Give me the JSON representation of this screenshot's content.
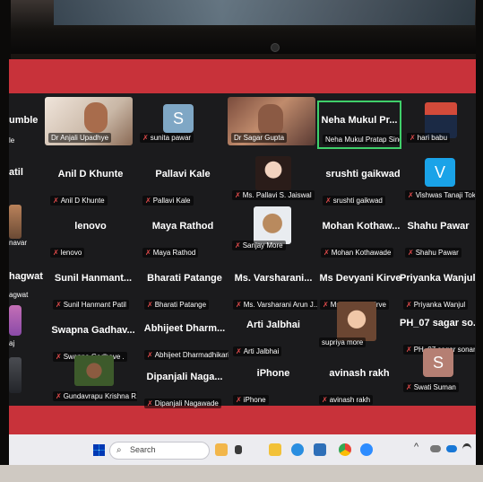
{
  "tiles": [
    {
      "name": "",
      "label": "Dr Anjali Upadhye"
    },
    {
      "name": "",
      "label": "sunita pawar",
      "avatar": "S"
    },
    {
      "name": "",
      "label": "Dr Sagar Gupta"
    },
    {
      "name": "Neha Mukul Pr...",
      "label": "Neha Mukul Pratap Singh"
    },
    {
      "name": "",
      "label": "hari babu"
    },
    {
      "name": "Anil D Khunte",
      "label": "Anil D Khunte"
    },
    {
      "name": "Pallavi Kale",
      "label": "Pallavi Kale"
    },
    {
      "name": "",
      "label": "Ms. Pallavi S. Jaiswal"
    },
    {
      "name": "srushti gaikwad",
      "label": "srushti gaikwad"
    },
    {
      "name": "",
      "label": "Vishwas Tanaji Toke",
      "avatar": "V"
    },
    {
      "name": "lenovo",
      "label": "lenovo"
    },
    {
      "name": "Maya Rathod",
      "label": "Maya Rathod"
    },
    {
      "name": "",
      "label": "Sanjay More"
    },
    {
      "name": "Mohan Kothaw...",
      "label": "Mohan Kothawade"
    },
    {
      "name": "Shahu Pawar",
      "label": "Shahu Pawar"
    },
    {
      "name": "Sunil Hanmant...",
      "label": "Sunil Hanmant Patil"
    },
    {
      "name": "Bharati Patange",
      "label": "Bharati Patange"
    },
    {
      "name": "Ms. Varsharani...",
      "label": "Ms. Varsharani Arun J..."
    },
    {
      "name": "Ms Devyani Kirve",
      "label": "Ms Devyani Kirve"
    },
    {
      "name": "Priyanka Wanjul",
      "label": "Priyanka Wanjul"
    },
    {
      "name": "Swapna Gadhav...",
      "label": "Swapna Gadhave ."
    },
    {
      "name": "Abhijeet Dharm...",
      "label": "Abhijeet Dharmadhikari"
    },
    {
      "name": "Arti Jalbhai",
      "label": "Arti Jalbhai"
    },
    {
      "name": "",
      "label": "supriya more"
    },
    {
      "name": "PH_07 sagar so...",
      "label": "PH_07 sagar sonar"
    },
    {
      "name": "",
      "label": "Gundavrapu Krishna R..."
    },
    {
      "name": "Dipanjali Naga...",
      "label": "Dipanjali Nagawade"
    },
    {
      "name": "iPhone",
      "label": "iPhone"
    },
    {
      "name": "avinash rakh",
      "label": "avinash rakh"
    },
    {
      "name": "",
      "label": "Swati Suman",
      "avatar": "S"
    }
  ],
  "edge": {
    "row1_name": "umble",
    "row1_label": "le",
    "row2_name": "atil",
    "row3_label": "navar",
    "row4_name": "hagwat",
    "row4_label": "agwat",
    "row5_label": "aj"
  },
  "taskbar": {
    "search_placeholder": "Search"
  },
  "colors": {
    "accent_red": "#c8323a",
    "grid_bg": "#1b1b1d",
    "active_speaker_border": "#3fd06a",
    "muted_mic": "#e24b4b"
  }
}
